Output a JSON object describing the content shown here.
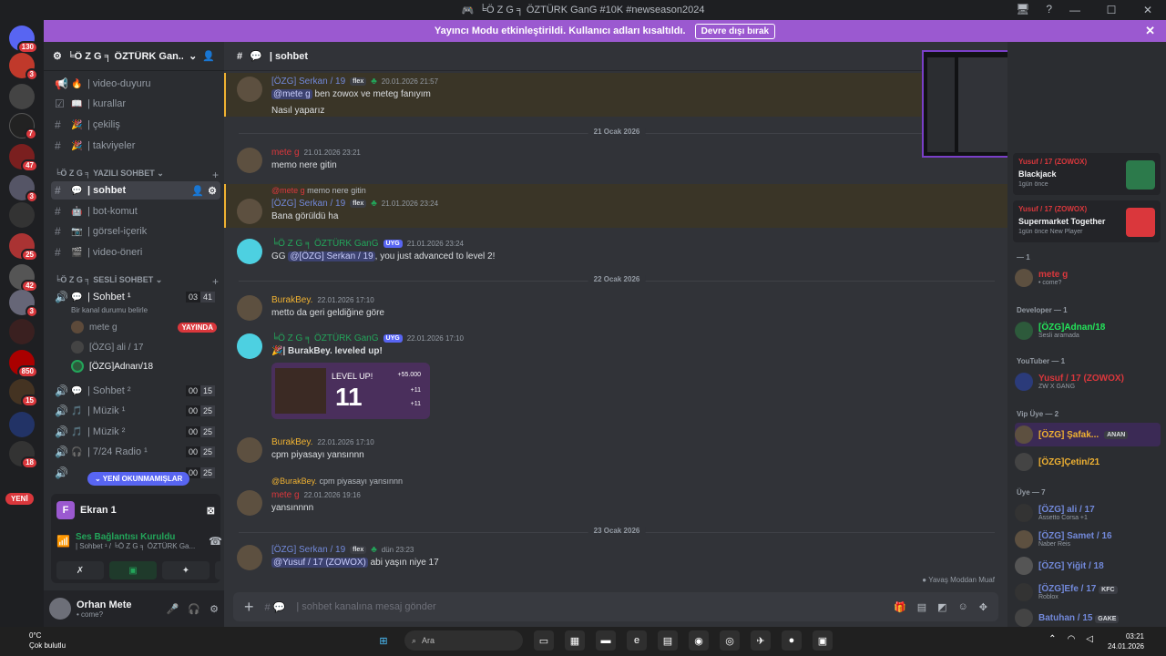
{
  "window": {
    "title": "╘Ö Z G ╕ ÖZTÜRK GanG #10K #newseason2024"
  },
  "banner": {
    "text": "Yayıncı Modu etkinleştirildi. Kullanıcı adları kısaltıldı.",
    "button": "Devre dışı bırak"
  },
  "guild_badges": [
    "130",
    "3",
    "7",
    "47",
    "3",
    "25",
    "42",
    "3",
    "850",
    "15",
    "18",
    "41"
  ],
  "yeni": "YENİ",
  "server": {
    "name": "╘Ö Z G ╕ ÖZTÜRK Gan..."
  },
  "channels_top": [
    {
      "label": "| video-duyuru",
      "emoji": "🔥"
    },
    {
      "label": "| kurallar",
      "emoji": "📖"
    },
    {
      "label": "| çekiliş",
      "emoji": "🎉"
    },
    {
      "label": "| takviyeler",
      "emoji": "🎉"
    }
  ],
  "cat_text": "╘Ö Z G ╕ YAZILI SOHBET",
  "channels_text": [
    {
      "label": "| sohbet",
      "emoji": "💬"
    },
    {
      "label": "| bot-komut",
      "emoji": "🤖"
    },
    {
      "label": "| görsel-içerik",
      "emoji": "📷"
    },
    {
      "label": "| video-öneri",
      "emoji": "🎬"
    }
  ],
  "cat_voice": "╘Ö Z G ╕ SESLİ SOHBET",
  "voice_main": {
    "label": "| Sohbet ¹",
    "c1": "03",
    "c2": "41",
    "status": "Bir kanal durumu belirle"
  },
  "voice_users": [
    {
      "name": "mete g",
      "live": "YAYINDA"
    },
    {
      "name": "[ÖZG] ali / 17",
      "live": ""
    },
    {
      "name": "[ÖZG]Adnan/18",
      "live": ""
    }
  ],
  "voice_channels": [
    {
      "label": "| Sohbet ²",
      "c1": "00",
      "c2": "15"
    },
    {
      "label": "| Müzik ¹",
      "c1": "00",
      "c2": "25"
    },
    {
      "label": "| Müzik ²",
      "c1": "00",
      "c2": "25"
    },
    {
      "label": "| 7/24 Radio ¹",
      "c1": "00",
      "c2": "25"
    },
    {
      "label": "",
      "c1": "00",
      "c2": "25"
    }
  ],
  "unread_pill": "YENİ OKUNMAMIŞLAR",
  "panel": {
    "screen": "Ekran 1",
    "f": "F",
    "voice_title": "Ses Bağlantısı Kuruldu",
    "voice_sub": "| Sohbet ¹ / ╘Ö Z G ╕ ÖZTÜRK Ga..."
  },
  "user": {
    "name": "Orhan Mete",
    "status": "• come?"
  },
  "channel_header": "| sohbet",
  "messages": {
    "m1": {
      "author": "[ÖZG] Serkan / 19",
      "tag": "flex",
      "time": "20.01.2026 21:57",
      "mention": "@mete g",
      "line1": " ben zowox ve meteg fanıyım",
      "line2": "Nasıl yaparız"
    },
    "d1": "21 Ocak 2026",
    "m2": {
      "author": "mete g",
      "time": "21.01.2026 23:21",
      "text": "memo nere gitin"
    },
    "m3": {
      "reply_author": "@mete g",
      "reply": "memo nere gitin",
      "author": "[ÖZG] Serkan / 19",
      "tag": "flex",
      "time": "21.01.2026 23:24",
      "text": "Bana görüldü ha"
    },
    "m4": {
      "author": "╘Ö Z G ╕ ÖZTÜRK GanG",
      "tag": "UYG",
      "time": "21.01.2026 23:24",
      "pre": "GG ",
      "mention": "@[ÖZG] Serkan / 19",
      "text": ", you just advanced to level 2!"
    },
    "d2": "22 Ocak 2026",
    "m5": {
      "author": "BurakBey.",
      "time": "22.01.2026 17:10",
      "text": "metto da geri geldiğine göre"
    },
    "m6": {
      "author": "╘Ö Z G ╕ ÖZTÜRK GanG",
      "tag": "UYG",
      "time": "22.01.2026 17:10",
      "text": "| BurakBey. leveled up!",
      "lvl_label": "LEVEL UP!",
      "lvl_num": "11",
      "r1": "+55.000",
      "r2": "+11",
      "r3": "+11"
    },
    "m7": {
      "author": "BurakBey.",
      "time": "22.01.2026 17:10",
      "text": "cpm piyasayı yansınnn"
    },
    "m8": {
      "reply_author": "@BurakBey.",
      "reply": "cpm piyasayı yansınnn",
      "author": "mete g",
      "time": "22.01.2026 19:16",
      "text": "yansınnnn"
    },
    "d3": "23 Ocak 2026",
    "m9": {
      "author": "[ÖZG] Serkan / 19",
      "tag": "flex",
      "time": "dün 23:23",
      "mention": "@Yusuf / 17 (ZOWOX)",
      "text": " abi yaşın niye 17"
    }
  },
  "slowmode": "Yavaş Moddan Muaf",
  "composer": {
    "placeholder": "| sohbet kanalına mesaj gönder"
  },
  "members": {
    "cards": [
      {
        "owner": "Yusuf / 17 (ZOWOX)",
        "title": "Blackjack",
        "sub": "1gün önce"
      },
      {
        "owner": "Yusuf / 17 (ZOWOX)",
        "title": "Supermarket Together",
        "sub": "1gün önce  New Player"
      }
    ],
    "groups": [
      {
        "label": "— 1",
        "items": [
          {
            "name": "mete g",
            "sub": "• come?",
            "color": "#da373c"
          }
        ]
      },
      {
        "label": "Developer — 1",
        "items": [
          {
            "name": "[ÖZG]Adnan/18",
            "sub": "Sesli aramada",
            "color": "#23e55a"
          }
        ]
      },
      {
        "label": "YouTuber — 1",
        "items": [
          {
            "name": "Yusuf / 17 (ZOWOX)",
            "sub": "ZW X GANG",
            "color": "#da373c"
          }
        ]
      },
      {
        "label": "Vip Üye — 2",
        "items": [
          {
            "name": "[ÖZG] Şafak...",
            "sub": "",
            "badge": "ANAN",
            "color": "#f0b232"
          },
          {
            "name": "[ÖZG]Çetin/21",
            "sub": "",
            "color": "#f0b232"
          }
        ]
      },
      {
        "label": "Üye — 7",
        "items": [
          {
            "name": "[ÖZG] ali / 17",
            "sub": "Assetto Corsa +1",
            "color": "#7289da"
          },
          {
            "name": "[ÖZG] Samet / 16",
            "sub": "Naber Reis",
            "color": "#7289da"
          },
          {
            "name": "[ÖZG] Yiğit / 18",
            "sub": "",
            "color": "#7289da"
          },
          {
            "name": "[ÖZG]Efe / 17",
            "sub": "Roblox",
            "badge": "KFC",
            "color": "#7289da"
          },
          {
            "name": "Batuhan / 15",
            "sub": "",
            "badge": "GAKE",
            "color": "#7289da"
          }
        ]
      }
    ]
  },
  "taskbar": {
    "temp": "0°C",
    "weather": "Çok bulutlu",
    "search": "Ara",
    "time": "03:21",
    "date": "24.01.2026"
  }
}
